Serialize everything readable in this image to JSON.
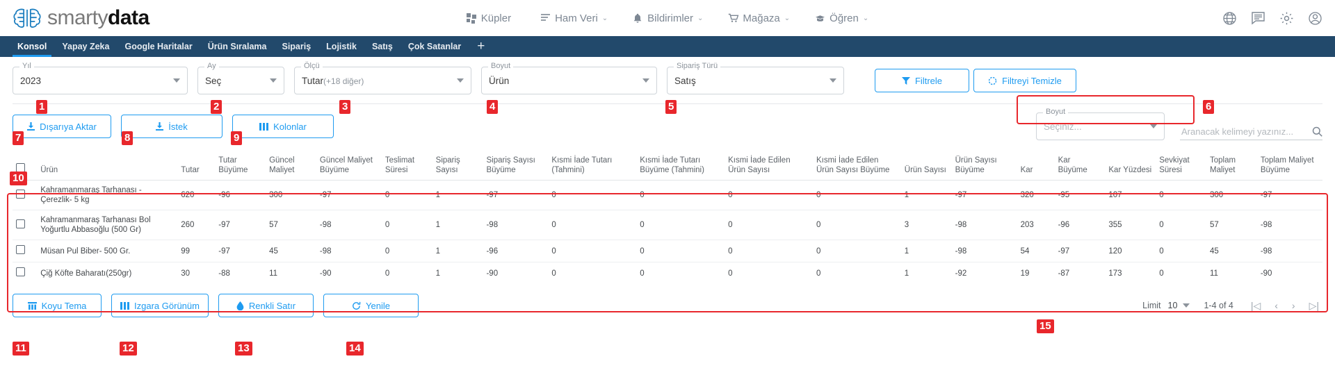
{
  "brand": {
    "part1": "smarty",
    "part2": "data",
    "logo_icon": "brain-logo-icon"
  },
  "topnav": [
    {
      "label": "Küpler",
      "icon": "cubes-icon",
      "caret": ""
    },
    {
      "label": "Ham Veri",
      "icon": "list-icon",
      "caret": "⌄"
    },
    {
      "label": "Bildirimler",
      "icon": "bell-icon",
      "caret": "⌄"
    },
    {
      "label": "Mağaza",
      "icon": "cart-icon",
      "caret": "⌄"
    },
    {
      "label": "Öğren",
      "icon": "book-icon",
      "caret": "⌄"
    }
  ],
  "topicons": [
    {
      "name": "globe-icon"
    },
    {
      "name": "chat-icon"
    },
    {
      "name": "gear-icon"
    },
    {
      "name": "account-icon"
    }
  ],
  "tabs": [
    {
      "label": "Konsol",
      "active": true
    },
    {
      "label": "Yapay Zeka",
      "active": false
    },
    {
      "label": "Google Haritalar",
      "active": false
    },
    {
      "label": "Ürün Sıralama",
      "active": false
    },
    {
      "label": "Sipariş",
      "active": false
    },
    {
      "label": "Lojistik",
      "active": false
    },
    {
      "label": "Satış",
      "active": false
    },
    {
      "label": "Çok Satanlar",
      "active": false
    }
  ],
  "tab_add_label": "+",
  "filters": [
    {
      "label": "Yıl",
      "value": "2023",
      "sub": "",
      "marker": "1"
    },
    {
      "label": "Ay",
      "value": "Seç",
      "sub": "",
      "marker": "2"
    },
    {
      "label": "Ölçü",
      "value": "Tutar",
      "sub": "(+18 diğer)",
      "marker": "3"
    },
    {
      "label": "Boyut",
      "value": "Ürün",
      "sub": "",
      "marker": "4"
    },
    {
      "label": "Sipariş Türü",
      "value": "Satış",
      "sub": "",
      "marker": "5"
    }
  ],
  "filter_buttons": {
    "filtrele": "Filtrele",
    "temizle": "Filtreyi Temizle",
    "marker": "6"
  },
  "action_buttons": [
    {
      "label": "Dışarıya Aktar",
      "icon": "download-icon",
      "marker": "7"
    },
    {
      "label": "İstek",
      "icon": "download-icon",
      "marker": "8"
    },
    {
      "label": "Kolonlar",
      "icon": "columns-icon",
      "marker": "9"
    }
  ],
  "right_tools": {
    "boyut_label": "Boyut",
    "boyut_value": "Seçiniz...",
    "search_placeholder": "Aranacak kelimeyi yazınız...",
    "search_value": "",
    "search_icon": "search-icon"
  },
  "table": {
    "marker": "10",
    "columns": [
      "Ürün",
      "Tutar",
      "Tutar Büyüme",
      "Güncel Maliyet",
      "Güncel Maliyet Büyüme",
      "Teslimat Süresi",
      "Sipariş Sayısı",
      "Sipariş Sayısı Büyüme",
      "Kısmi İade Tutarı (Tahmini)",
      "Kısmi İade Tutarı Büyüme (Tahmini)",
      "Kısmi İade Edilen Ürün Sayısı",
      "Kısmi İade Edilen Ürün Sayısı Büyüme",
      "Ürün Sayısı",
      "Ürün Sayısı Büyüme",
      "Kar",
      "Kar Büyüme",
      "Kar Yüzdesi",
      "Sevkiyat Süresi",
      "Toplam Maliyet",
      "Toplam Maliyet Büyüme"
    ],
    "rows": [
      {
        "urun": "Kahramanmaraş Tarhanası - Çerezlik- 5 kg",
        "cells": [
          "620",
          "-96",
          "300",
          "-97",
          "0",
          "1",
          "-97",
          "0",
          "0",
          "0",
          "0",
          "1",
          "-97",
          "320",
          "-95",
          "107",
          "0",
          "300",
          "-97"
        ]
      },
      {
        "urun": "Kahramanmaraş Tarhanası Bol Yoğurtlu Abbasoğlu (500 Gr)",
        "cells": [
          "260",
          "-97",
          "57",
          "-98",
          "0",
          "1",
          "-98",
          "0",
          "0",
          "0",
          "0",
          "3",
          "-98",
          "203",
          "-96",
          "355",
          "0",
          "57",
          "-98"
        ]
      },
      {
        "urun": "Müsan Pul Biber- 500 Gr.",
        "cells": [
          "99",
          "-97",
          "45",
          "-98",
          "0",
          "1",
          "-96",
          "0",
          "0",
          "0",
          "0",
          "1",
          "-98",
          "54",
          "-97",
          "120",
          "0",
          "45",
          "-98"
        ]
      },
      {
        "urun": "Çiğ Köfte Baharatı(250gr)",
        "cells": [
          "30",
          "-88",
          "11",
          "-90",
          "0",
          "1",
          "-90",
          "0",
          "0",
          "0",
          "0",
          "1",
          "-92",
          "19",
          "-87",
          "173",
          "0",
          "11",
          "-90"
        ]
      }
    ]
  },
  "footer_buttons": [
    {
      "label": "Koyu Tema",
      "icon": "theme-icon",
      "marker": "11"
    },
    {
      "label": "Izgara Görünüm",
      "icon": "grid-icon",
      "marker": "12"
    },
    {
      "label": "Renkli Satır",
      "icon": "droplet-icon",
      "marker": "13"
    },
    {
      "label": "Yenile",
      "icon": "refresh-icon",
      "marker": "14"
    }
  ],
  "pagination": {
    "marker": "15",
    "limit_label": "Limit",
    "limit_value": "10",
    "range_text": "1-4 of 4",
    "first_icon": "|◁",
    "prev_icon": "‹",
    "next_icon": "›",
    "last_icon": "▷|"
  },
  "colors": {
    "accent": "#1e9bf0",
    "navy": "#22496b",
    "marker": "#e8272c"
  }
}
